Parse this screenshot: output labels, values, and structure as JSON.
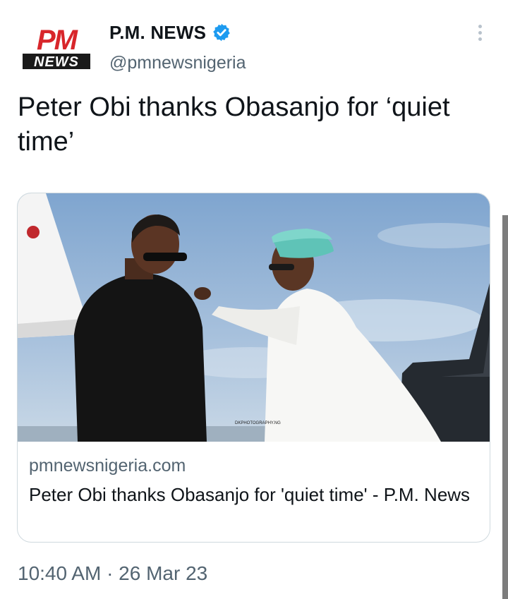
{
  "author": {
    "display_name": "P.M. NEWS",
    "handle": "@pmnewsnigeria",
    "verified": true,
    "avatar_logo": {
      "top": "PM",
      "bottom": "NEWS"
    }
  },
  "tweet": {
    "text": "Peter Obi thanks Obasanjo for ‘quiet time’",
    "timestamp": "10:40 AM · 26 Mar 23"
  },
  "card": {
    "domain": "pmnewsnigeria.com",
    "title": "Peter Obi thanks Obasanjo for 'quiet time' - P.M. News",
    "image_watermark": "DKPHOTOGRAPHY.NG"
  },
  "icons": {
    "verified": "verified-badge-icon",
    "more": "more-options-icon"
  },
  "colors": {
    "verified_blue": "#1d9bf0",
    "logo_red": "#d8262b",
    "text_primary": "#0f1419",
    "text_secondary": "#536471"
  }
}
